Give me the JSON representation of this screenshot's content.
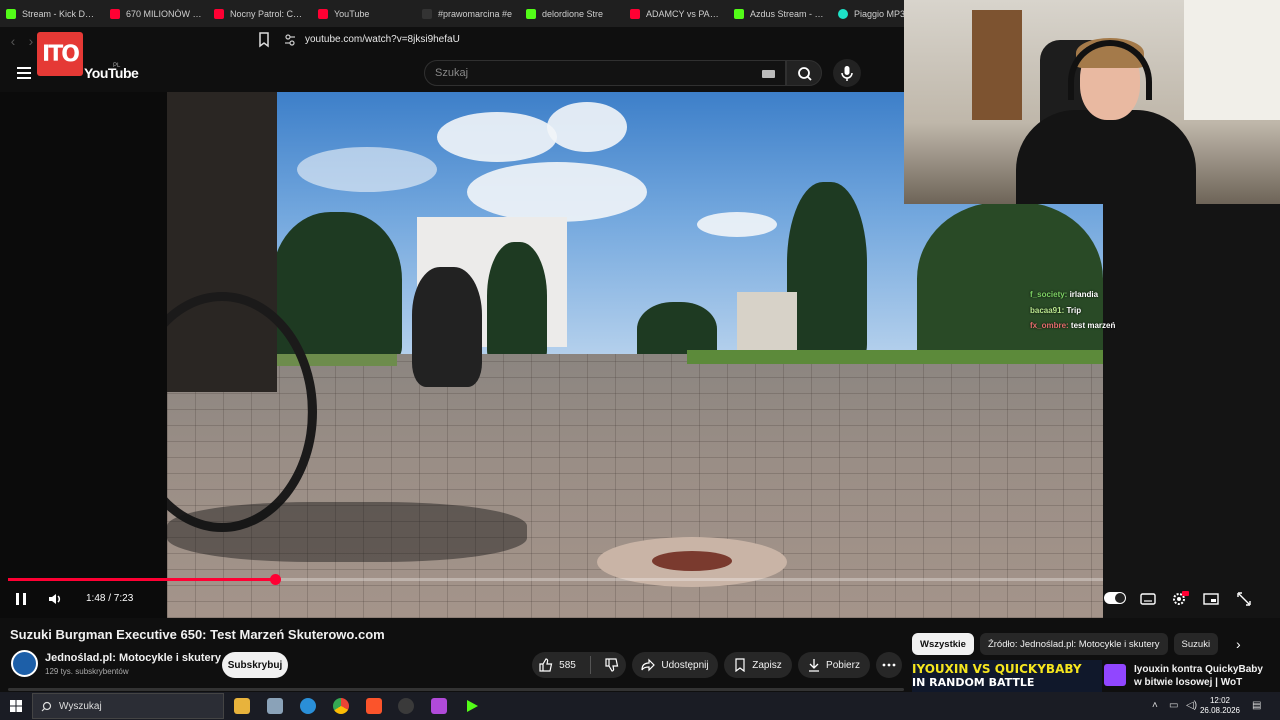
{
  "browser": {
    "tabs": [
      {
        "label": "Stream - Kick Dashb",
        "icon_color": "#53fc18"
      },
      {
        "label": "670 MILIONÓW NA",
        "icon_color": "#ff0033"
      },
      {
        "label": "Nocny Patrol: Czym",
        "icon_color": "#ff0033"
      },
      {
        "label": "YouTube",
        "icon_color": "#ff0033"
      },
      {
        "label": "#prawomarcina #e",
        "icon_color": "#ffffff"
      },
      {
        "label": "delordione Stre",
        "icon_color": "#53fc18"
      },
      {
        "label": "ADAMCY vs PAJAC",
        "icon_color": "#ff0033"
      },
      {
        "label": "Azdus Stream - Wa",
        "icon_color": "#53fc18"
      },
      {
        "label": "Piaggio MP3 300h",
        "icon_color": "#1ee3c8"
      }
    ],
    "url": "youtube.com/watch?v=8jksi9hefaU"
  },
  "youtube": {
    "logo_badge": "ΙΤΟ",
    "logo_word": "YouTube",
    "logo_region": "PL",
    "search_placeholder": "Szukaj"
  },
  "player": {
    "time": "1:48 / 7:23",
    "progress": 0.244
  },
  "chat": [
    {
      "user": "f_society:",
      "text": " irlandia"
    },
    {
      "user": "bacaa91:",
      "text": " Trip"
    },
    {
      "user": "fx_ombre:",
      "text": " test marzeń"
    }
  ],
  "video": {
    "title": "Suzuki Burgman Executive 650: Test Marzeń Skuterowo.com",
    "channel": "Jednoślad.pl: Motocykle i skutery",
    "subscribers": "129 tys. subskrybentów",
    "subscribe_label": "Subskrybuj",
    "likes": "585",
    "share_label": "Udostępnij",
    "save_label": "Zapisz",
    "download_label": "Pobierz"
  },
  "chips": [
    "Wszystkie",
    "Źródło: Jednoślad.pl: Motocykle i skutery",
    "Suzuki"
  ],
  "recommendation": {
    "thumb_line1": "IYOUXIN VS QUICKYBABY",
    "thumb_line2": "IN RANDOM BATTLE",
    "title": "Iyouxin kontra QuickyBaby w bitwie losowej | WoT"
  },
  "taskbar": {
    "search_label": "Wyszukaj",
    "time": "12:02",
    "date": "26.08.2026"
  },
  "colors": {
    "accent_red": "#ff0033",
    "background": "#0f0f0f"
  }
}
